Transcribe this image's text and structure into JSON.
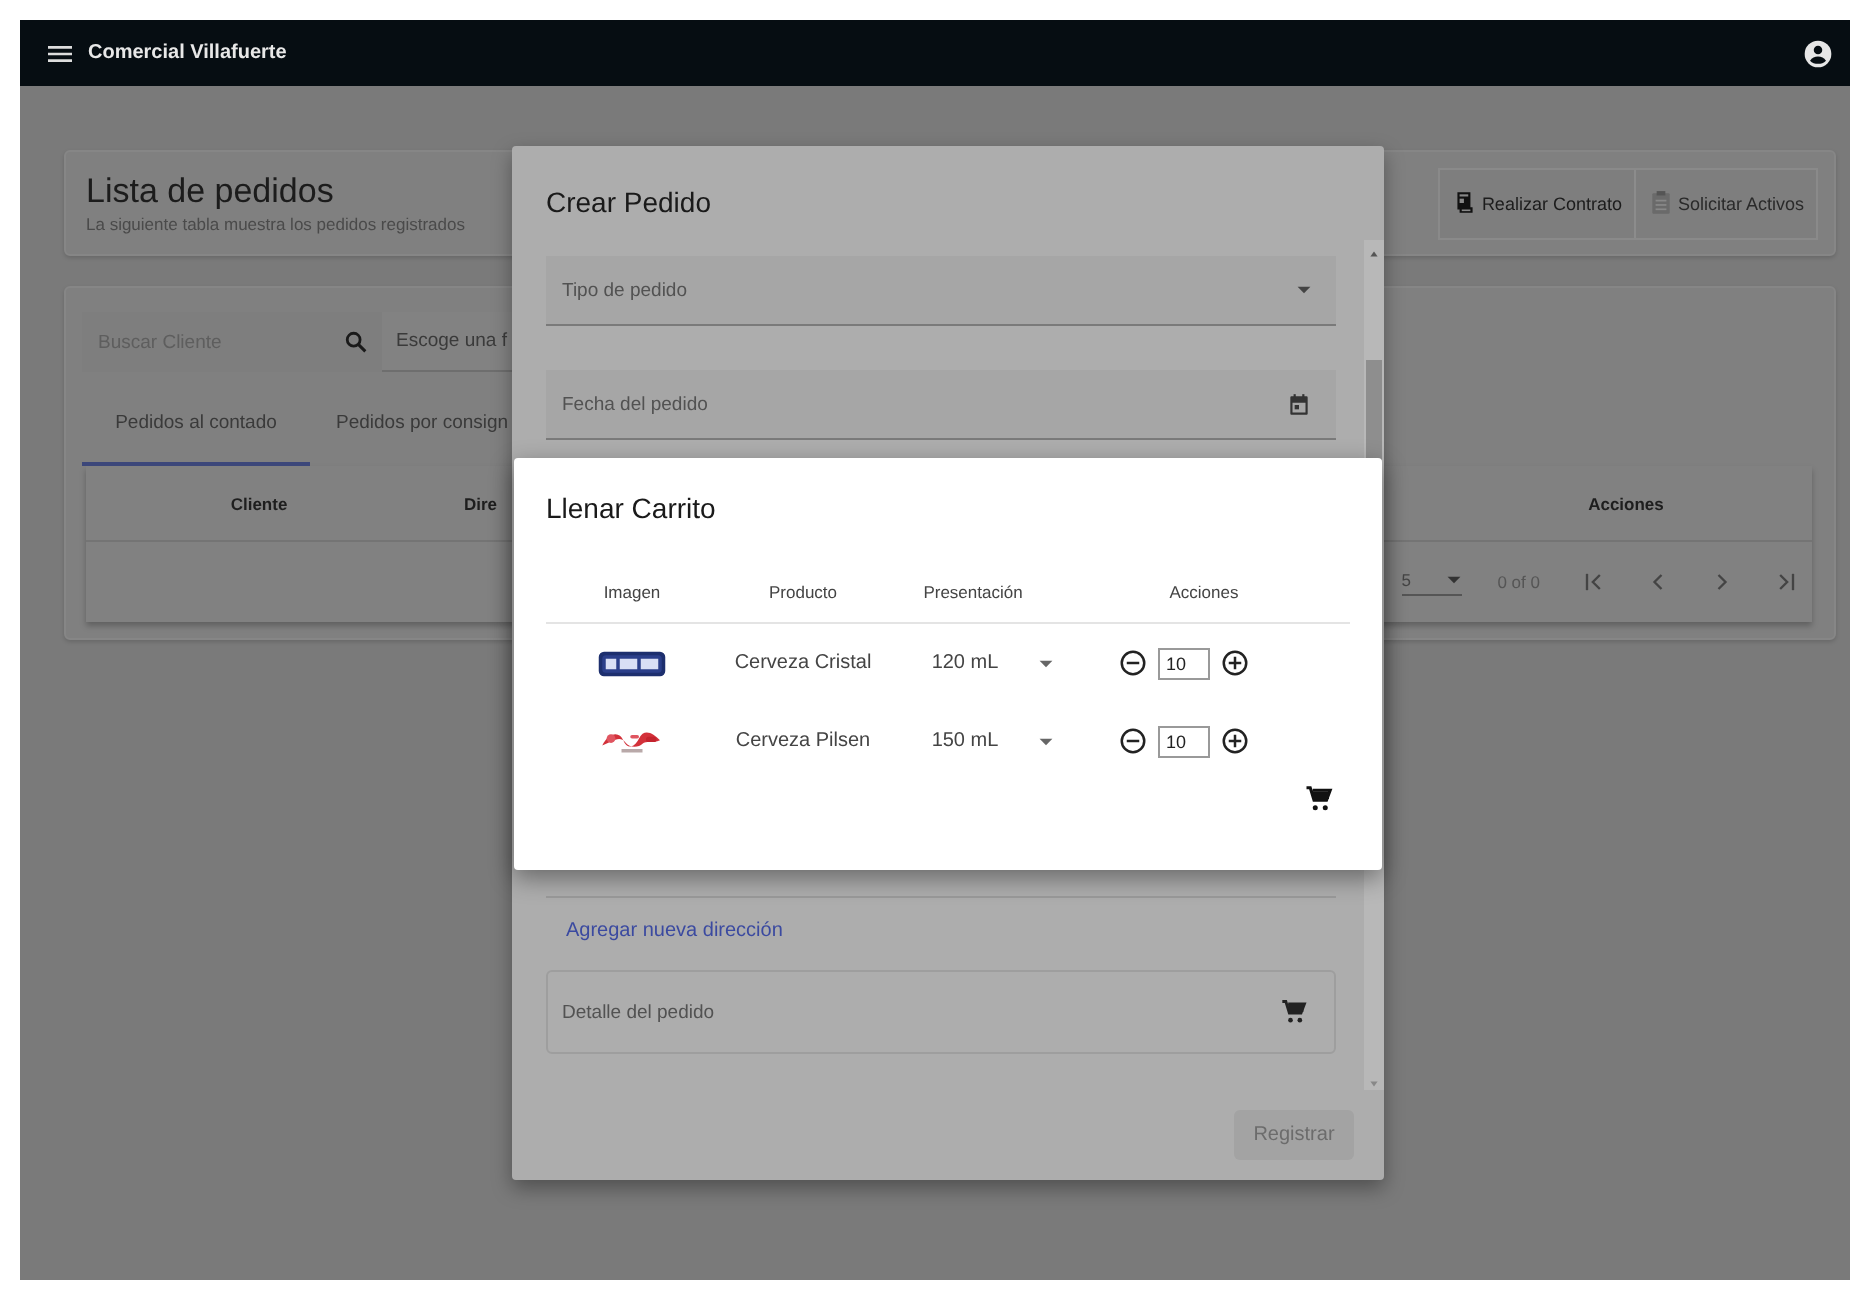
{
  "app_bar": {
    "title": "Comercial Villafuerte"
  },
  "page": {
    "title": "Lista de pedidos",
    "subtitle": "La siguiente tabla muestra los pedidos registrados",
    "actions": [
      "Realizar Contrato",
      "Solicitar Activos"
    ]
  },
  "filters": {
    "search_placeholder": "Buscar Cliente",
    "date_placeholder": "Escoge una f"
  },
  "tabs": [
    {
      "label": "Pedidos al contado",
      "selected": true
    },
    {
      "label": "Pedidos por consign",
      "selected": false
    }
  ],
  "table": {
    "columns": [
      "Cliente",
      "Dire",
      "Acciones"
    ],
    "paginator": {
      "page_size": "5",
      "range": "0 of 0"
    }
  },
  "crear_pedido": {
    "title": "Crear Pedido",
    "fields": [
      {
        "kind": "select",
        "placeholder": "Tipo de pedido"
      },
      {
        "kind": "date",
        "placeholder": "Fecha del pedido"
      }
    ],
    "link": "Agregar nueva dirección",
    "detail_placeholder": "Detalle del pedido",
    "submit": {
      "label": "Registrar",
      "disabled": true
    }
  },
  "llenar_carrito": {
    "title": "Llenar Carrito",
    "columns": [
      "Imagen",
      "Producto",
      "Presentación",
      "Acciones"
    ],
    "rows": [
      {
        "product": "Cerveza Cristal",
        "presentation": "120 mL",
        "quantity": "10"
      },
      {
        "product": "Cerveza Pilsen",
        "presentation": "150 mL",
        "quantity": "10"
      }
    ]
  }
}
